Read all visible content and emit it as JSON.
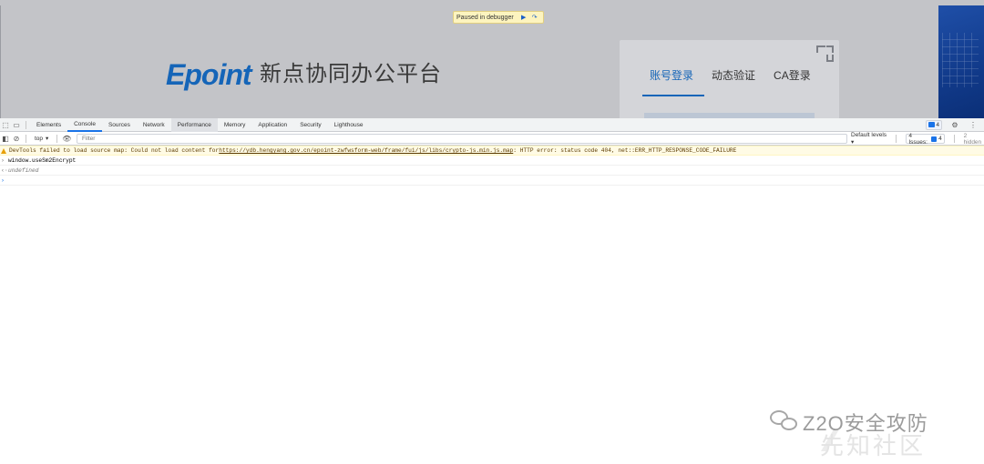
{
  "page": {
    "debugger_banner": "Paused in debugger",
    "logo_text": "Epoint",
    "platform_title": "新点协同办公平台",
    "login_tabs": [
      {
        "label": "账号登录",
        "active": true
      },
      {
        "label": "动态验证",
        "active": false
      },
      {
        "label": "CA登录",
        "active": false
      }
    ]
  },
  "devtools": {
    "tabs": [
      {
        "label": "Elements"
      },
      {
        "label": "Console",
        "active": true
      },
      {
        "label": "Sources"
      },
      {
        "label": "Network"
      },
      {
        "label": "Performance",
        "hovered": true
      },
      {
        "label": "Memory"
      },
      {
        "label": "Application"
      },
      {
        "label": "Security"
      },
      {
        "label": "Lighthouse"
      }
    ],
    "message_badge_count": "4",
    "toolbar": {
      "context": "top",
      "filter_placeholder": "Filter",
      "levels_label": "Default levels",
      "issues_label": "4 Issues:",
      "issues_count": "4",
      "hidden_label": "2 hidden"
    },
    "console": {
      "warning_prefix": "DevTools failed to load source map: Could not load content for ",
      "warning_url": "https://ydb.hengyang.gov.cn/epoint-zwfwsform-web/frame/fui/js/libs/crypto-js.min.js.map",
      "warning_suffix": ": HTTP error: status code 404, net::ERR_HTTP_RESPONSE_CODE_FAILURE",
      "input_line": "window.useSm2Encrypt",
      "result_line": "undefined"
    }
  },
  "watermark": {
    "main": "Z2O安全攻防",
    "sub": "先知社区"
  },
  "colors": {
    "accent_blue": "#1a73e8",
    "logo_blue": "#1565b8",
    "warning_bg": "#fffbe5",
    "paused_overlay": "#c3c4c8"
  }
}
